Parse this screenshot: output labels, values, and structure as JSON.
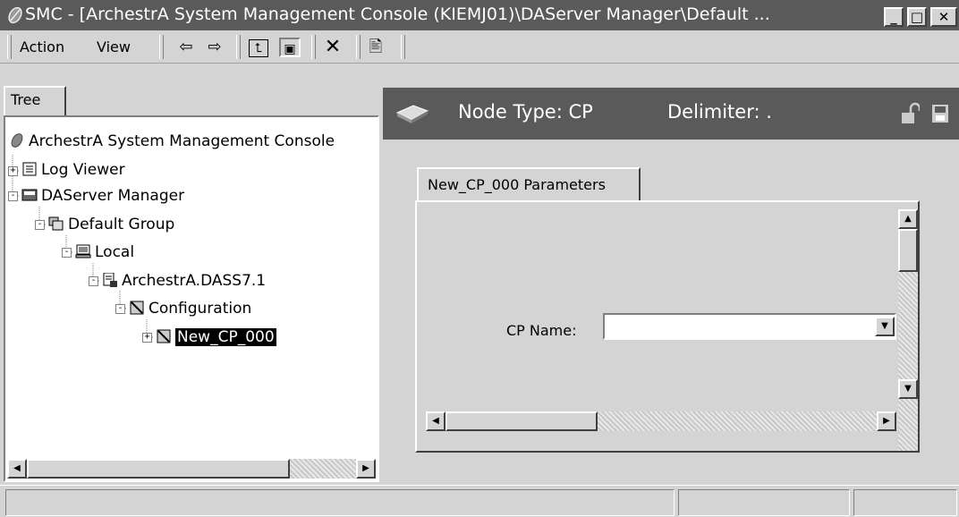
{
  "window": {
    "title": "SMC - [ArchestrA System Management Console (KIEMJ01)\\DAServer Manager\\Default ...",
    "minimize": "_",
    "maximize": "□",
    "close": "✕"
  },
  "menu": {
    "action": "Action",
    "view": "View"
  },
  "toolbar": {
    "back": "⇦",
    "forward": "⇨",
    "up": "⮤",
    "show_hide": "▣",
    "delete": "✕",
    "properties": "🖹"
  },
  "tree": {
    "tab_label": "Tree",
    "nodes": [
      {
        "label": "ArchestrA System Management Console",
        "icon": "smc-icon"
      },
      {
        "label": "Log Viewer",
        "icon": "log-viewer-icon"
      },
      {
        "label": "DAServer Manager",
        "icon": "daserver-manager-icon"
      },
      {
        "label": "Default Group",
        "icon": "group-icon"
      },
      {
        "label": "Local",
        "icon": "computer-icon"
      },
      {
        "label": "ArchestrA.DASS7.1",
        "icon": "daserver-icon"
      },
      {
        "label": "Configuration",
        "icon": "configuration-icon"
      },
      {
        "label": "New_CP_000",
        "icon": "cp-node-icon"
      }
    ]
  },
  "details": {
    "node_type": "Node Type: CP",
    "delimiter": "Delimiter: .",
    "tab_label": "New_CP_000 Parameters",
    "cp_name_label": "CP Name:",
    "cp_name_value": ""
  },
  "colors": {
    "titlebar": "#5a5a5a",
    "face": "#d4d4d4",
    "selection": "#000000"
  }
}
